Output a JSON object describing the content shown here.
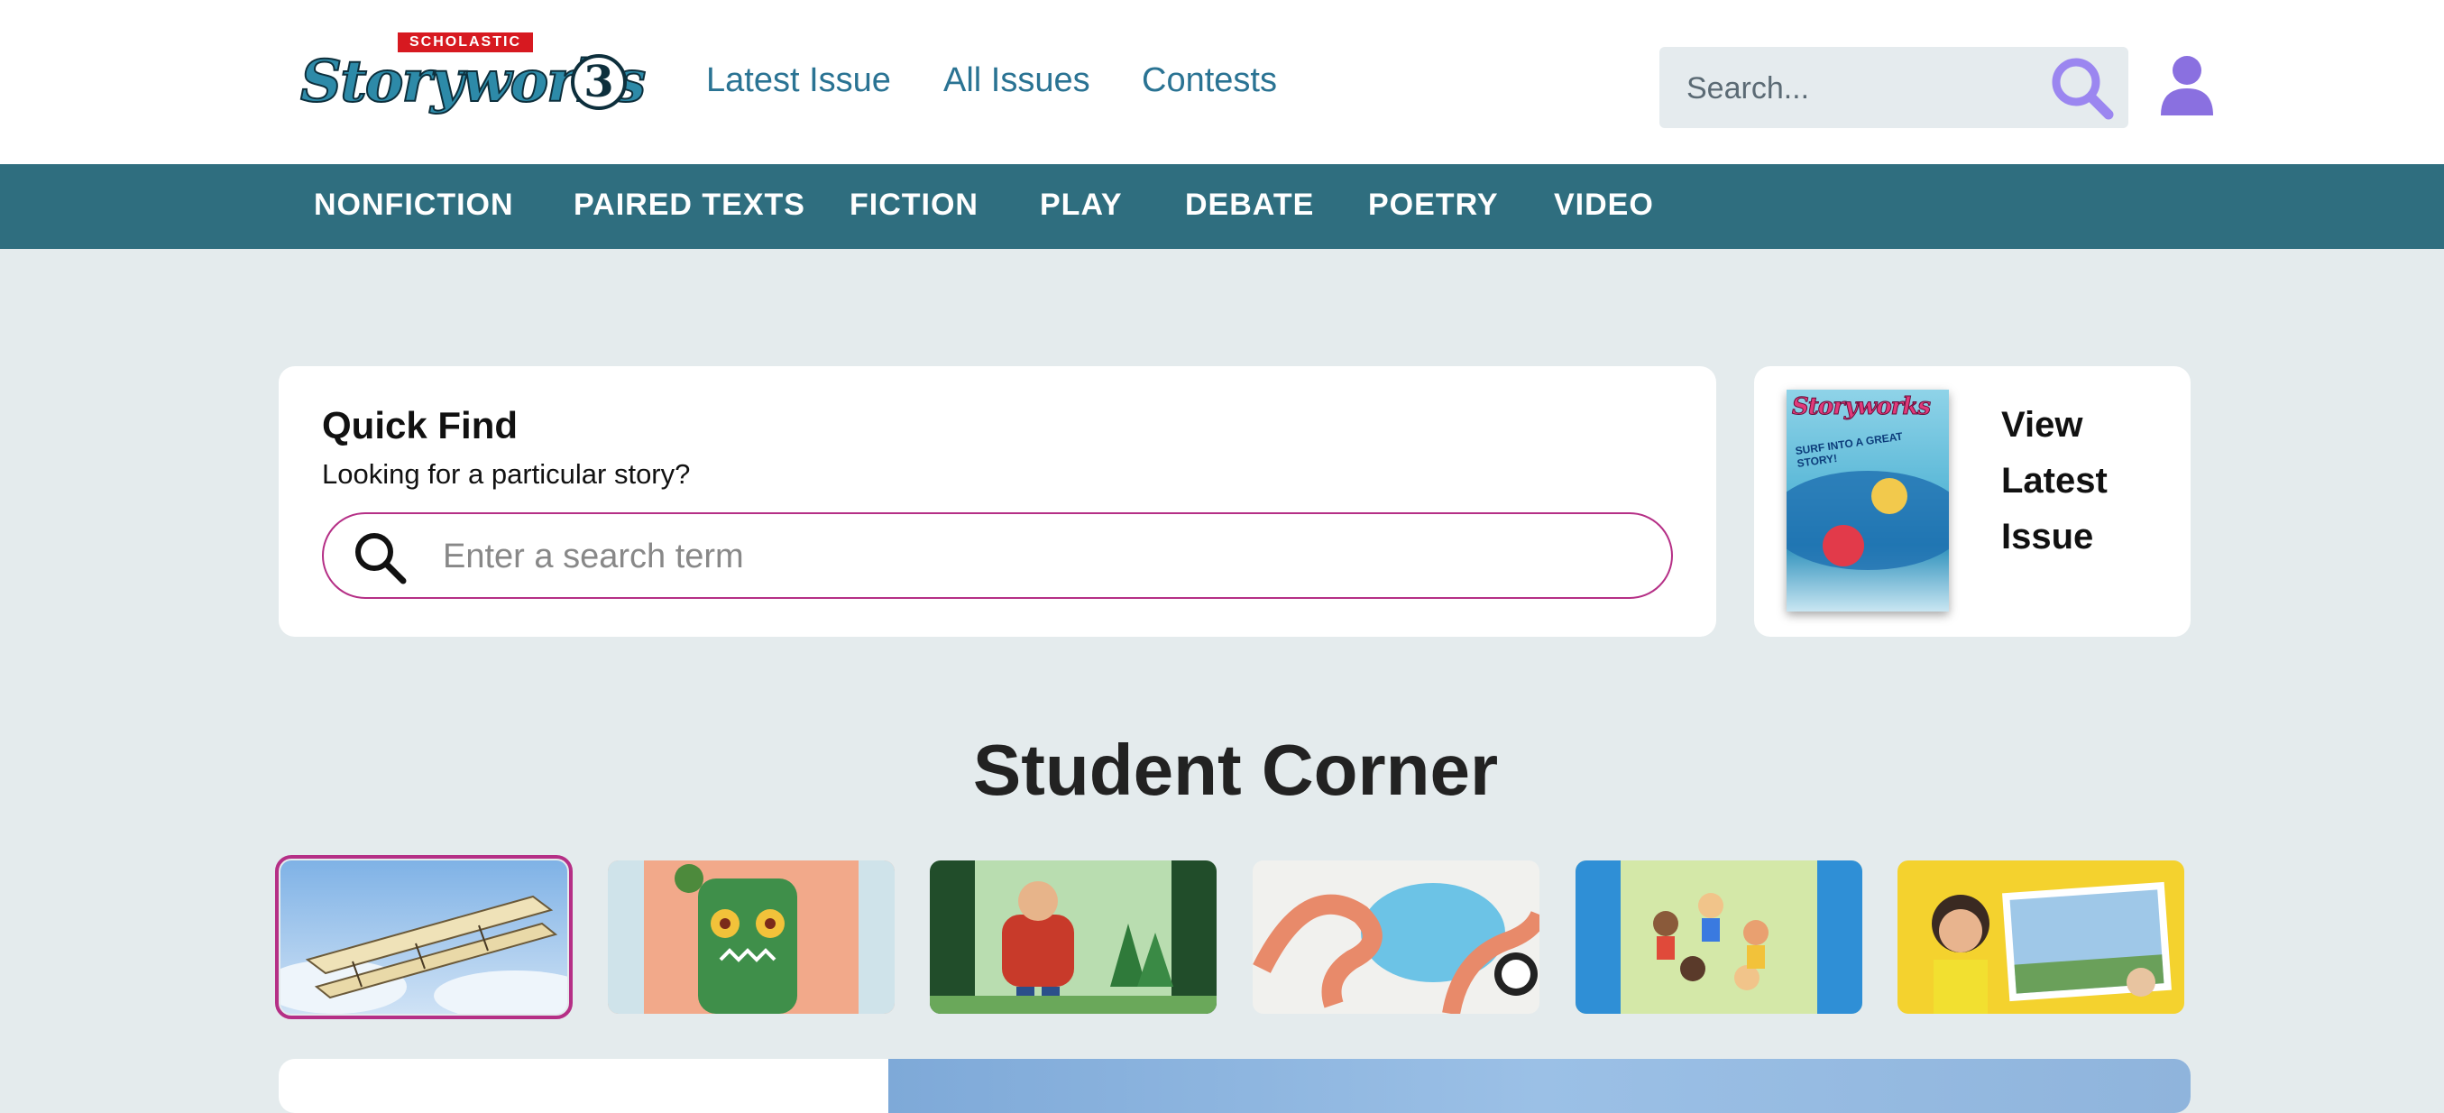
{
  "brand": {
    "badge": "SCHOLASTIC",
    "name": "Storyworks",
    "grade": "3"
  },
  "topnav": {
    "items": [
      {
        "label": "Latest Issue"
      },
      {
        "label": "All Issues"
      },
      {
        "label": "Contests"
      }
    ],
    "search_placeholder": "Search..."
  },
  "categories": [
    {
      "label": "NONFICTION"
    },
    {
      "label": "PAIRED TEXTS"
    },
    {
      "label": "FICTION"
    },
    {
      "label": "PLAY"
    },
    {
      "label": "DEBATE"
    },
    {
      "label": "POETRY"
    },
    {
      "label": "VIDEO"
    }
  ],
  "quick_find": {
    "title": "Quick Find",
    "subtitle": "Looking for a particular story?",
    "placeholder": "Enter a search term"
  },
  "latest_issue": {
    "cover_title": "Storyworks",
    "cover_tagline": "SURF INTO A GREAT STORY!",
    "lines": [
      "View",
      "Latest",
      "Issue"
    ]
  },
  "student_corner": {
    "title": "Student Corner",
    "thumbnails": [
      {
        "subject": "airplane",
        "selected": true
      },
      {
        "subject": "monster-doll",
        "selected": false
      },
      {
        "subject": "lumberjack",
        "selected": false
      },
      {
        "subject": "octopus",
        "selected": false
      },
      {
        "subject": "kids-group",
        "selected": false
      },
      {
        "subject": "girl-trampoline",
        "selected": false
      }
    ]
  },
  "colors": {
    "teal_bar": "#2f6e7f",
    "nav_link": "#2a7393",
    "accent_magenta": "#b52f86",
    "search_icon": "#9b86f0",
    "page_bg": "#e4ebed"
  }
}
